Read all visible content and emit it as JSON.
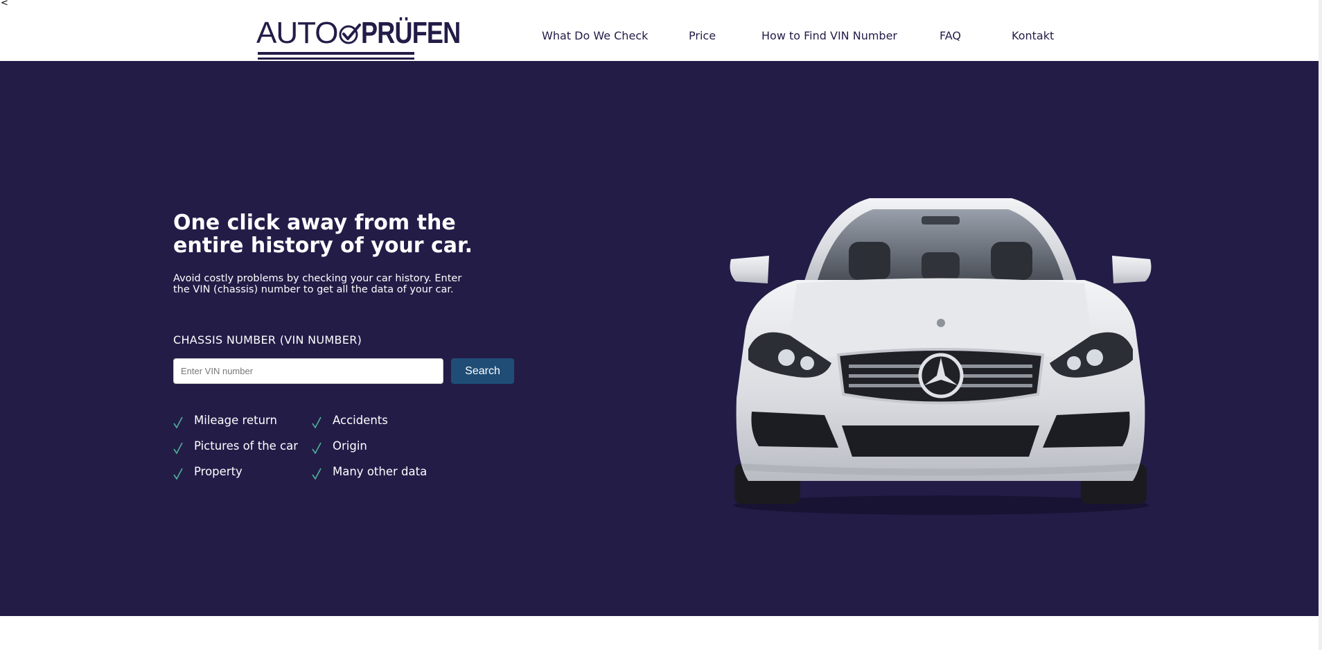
{
  "stray": "<",
  "logo": {
    "part1": "AUTO",
    "part2": "PRÜFEN"
  },
  "nav": {
    "items": [
      {
        "label": "What Do We Check"
      },
      {
        "label": "Price"
      },
      {
        "label": "How to Find VIN Number"
      },
      {
        "label": "FAQ"
      },
      {
        "label": "Kontakt"
      }
    ]
  },
  "hero": {
    "title": "One click away from the entire history of your car.",
    "subtitle": "Avoid costly problems by checking your car history. Enter the VIN (chassis) number to get all the data of your car.",
    "vin_label": "CHASSIS NUMBER (VIN NUMBER)",
    "vin_input": {
      "value": "",
      "placeholder": "Enter VIN number"
    },
    "search_label": "Search",
    "features": [
      "Mileage return",
      "Accidents",
      "Pictures of the car",
      "Origin",
      "Property",
      "Many other data"
    ]
  },
  "colors": {
    "brand_navy": "#231c47",
    "button_blue": "#1f4d76",
    "check_teal": "#4fb39a"
  }
}
